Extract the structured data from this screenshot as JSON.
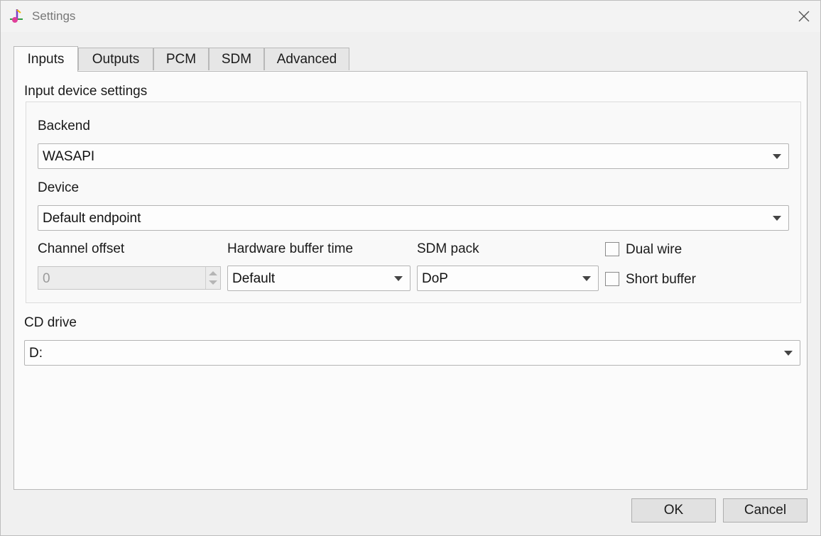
{
  "window": {
    "title": "Settings",
    "icon": "music-note-icon"
  },
  "tabs": [
    {
      "label": "Inputs",
      "active": true
    },
    {
      "label": "Outputs",
      "active": false
    },
    {
      "label": "PCM",
      "active": false
    },
    {
      "label": "SDM",
      "active": false
    },
    {
      "label": "Advanced",
      "active": false
    }
  ],
  "inputs": {
    "group_title": "Input device settings",
    "backend": {
      "label": "Backend",
      "value": "WASAPI"
    },
    "device": {
      "label": "Device",
      "value": "Default endpoint"
    },
    "channel_offset": {
      "label": "Channel offset",
      "value": "0"
    },
    "hardware_buffer_time": {
      "label": "Hardware buffer time",
      "value": "Default"
    },
    "sdm_pack": {
      "label": "SDM pack",
      "value": "DoP"
    },
    "dual_wire": {
      "label": "Dual wire",
      "checked": false
    },
    "short_buffer": {
      "label": "Short buffer",
      "checked": false
    },
    "cd_drive": {
      "label": "CD drive",
      "value": "D:"
    }
  },
  "buttons": {
    "ok": "OK",
    "cancel": "Cancel"
  }
}
